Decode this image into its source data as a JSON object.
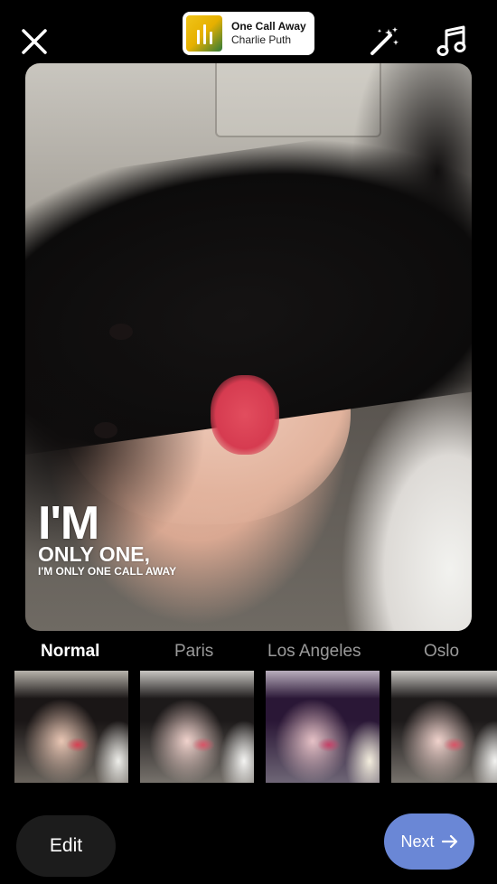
{
  "music": {
    "title": "One Call Away",
    "artist": "Charlie Puth"
  },
  "lyrics": {
    "line1": "I'M",
    "line2": "ONLY ONE,",
    "line3": "I'M ONLY ONE CALL AWAY"
  },
  "filters": [
    {
      "label": "Normal",
      "selected": true
    },
    {
      "label": "Paris",
      "selected": false
    },
    {
      "label": "Los Angeles",
      "selected": false
    },
    {
      "label": "Oslo",
      "selected": false
    }
  ],
  "buttons": {
    "edit_label": "Edit",
    "next_label": "Next"
  },
  "colors": {
    "background": "#000000",
    "next_button": "#6a87d6",
    "edit_button": "#1c1c1c"
  },
  "icons": {
    "close": "close-icon",
    "effects": "magic-wand-icon",
    "music": "music-note-icon",
    "next_arrow": "arrow-right-icon"
  }
}
